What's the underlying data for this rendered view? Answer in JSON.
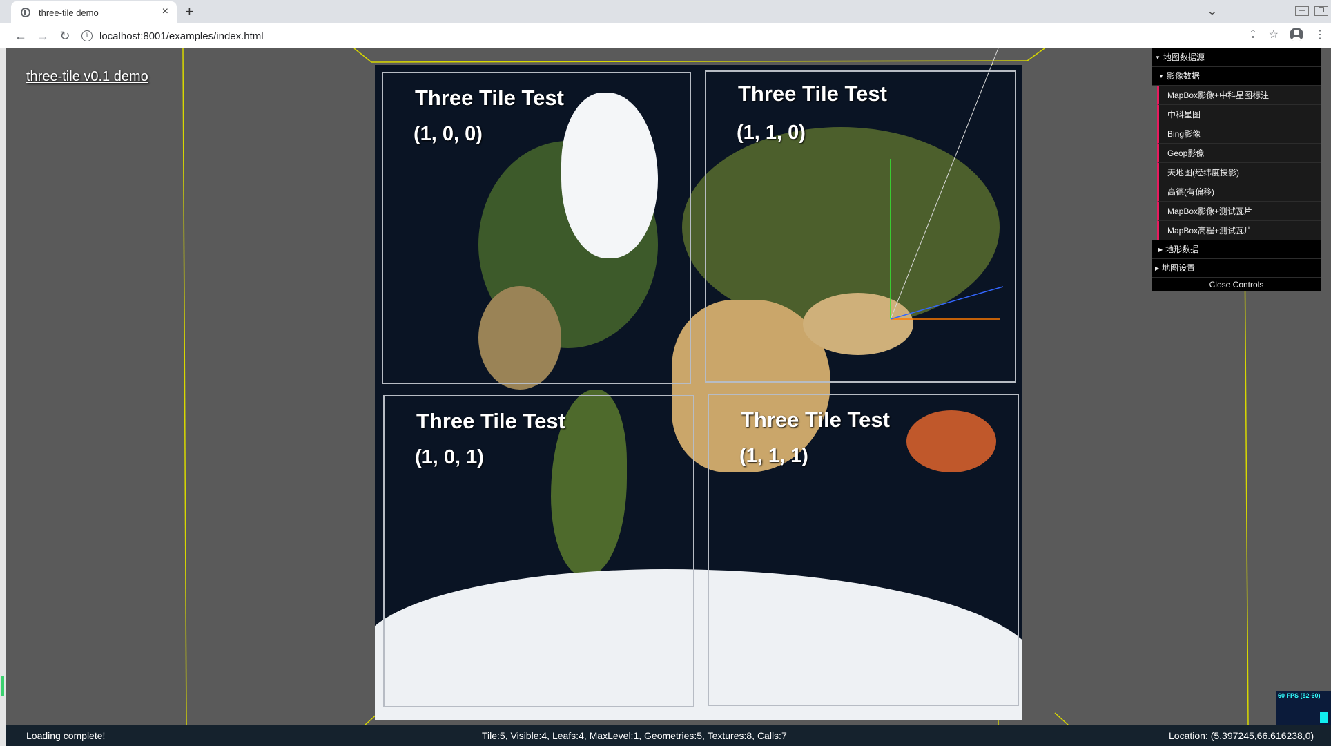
{
  "browser": {
    "tab_title": "three-tile demo",
    "tab_close": "×",
    "new_tab": "+",
    "tab_list": "⌄",
    "url": "localhost:8001/examples/index.html",
    "window_min": "—",
    "window_restore": "❐",
    "back": "←",
    "forward": "→",
    "reload": "↻",
    "share": "⇪",
    "bookmark": "☆",
    "menu": "⋮"
  },
  "app": {
    "title": "three-tile v0.1 demo"
  },
  "tiles": [
    {
      "title": "Three Tile Test",
      "coord": "(1, 0, 0)"
    },
    {
      "title": "Three Tile Test",
      "coord": "(1, 1, 0)"
    },
    {
      "title": "Three Tile Test",
      "coord": "(1, 0, 1)"
    },
    {
      "title": "Three Tile Test",
      "coord": "(1, 1, 1)"
    }
  ],
  "controls": {
    "folder_map_source": "地图数据源",
    "folder_imagery": "影像数据",
    "imagery_items": [
      "MapBox影像+中科星图标注",
      "中科星图",
      "Bing影像",
      "Geop影像",
      "天地图(经纬度投影)",
      "高德(有偏移)",
      "MapBox影像+测试瓦片",
      "MapBox高程+测试瓦片"
    ],
    "folder_terrain": "地形数据",
    "folder_settings": "地图设置",
    "close_label": "Close Controls"
  },
  "status": {
    "loading": "Loading complete!",
    "stats": "Tile:5, Visible:4, Leafs:4, MaxLevel:1, Geometries:5, Textures:8, Calls:7",
    "location": "Location: (5.397245,66.616238,0)"
  },
  "fps": {
    "label": "60 FPS (52-60)"
  },
  "colors": {
    "viewport_bg": "#5a5a5a",
    "accent": "#e61d5f",
    "bbox_line": "#e0e000",
    "axis_x": "#ff7a00",
    "axis_y": "#33ee33",
    "axis_z": "#3366ff"
  }
}
